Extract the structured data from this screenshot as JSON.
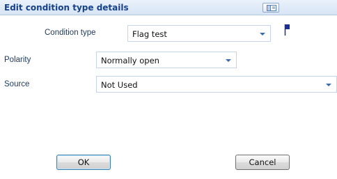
{
  "dialog": {
    "title": "Edit condition type details"
  },
  "condition_type": {
    "label": "Condition type",
    "value": "Flag test"
  },
  "polarity": {
    "label": "Polarity",
    "value": "Normally open"
  },
  "source": {
    "label": "Source",
    "value": "Not Used"
  },
  "buttons": {
    "ok_label": "OK",
    "cancel_label": "Cancel"
  },
  "icons": {
    "title_button": "window-restore-icon",
    "flag": "flag-icon"
  },
  "colors": {
    "title_text": "#15428b",
    "label_text": "#1e395b",
    "flag": "#1c2f8f",
    "arrow": "#3f6aa8"
  }
}
